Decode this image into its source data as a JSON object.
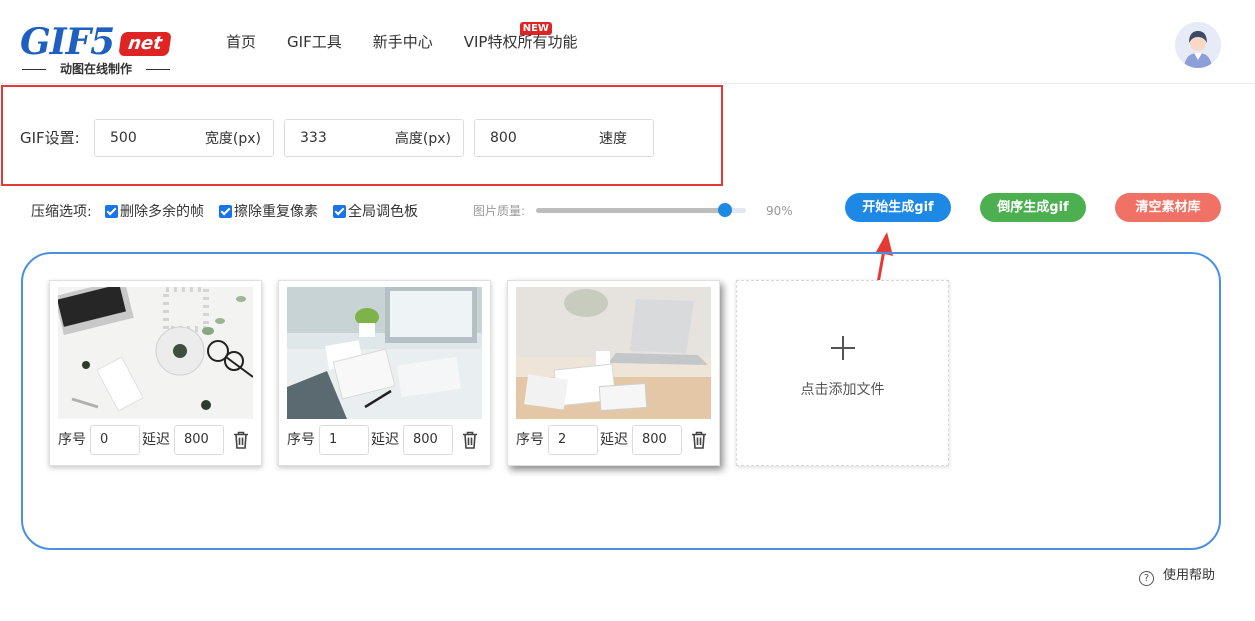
{
  "brand": {
    "logo_text": "GIF5",
    "logo_suffix": "net",
    "tagline": "动图在线制作"
  },
  "nav": [
    {
      "label": "首页"
    },
    {
      "label": "GIF工具"
    },
    {
      "label": "新手中心"
    },
    {
      "label": "VIP特权",
      "badge": "NEW"
    },
    {
      "label": "所有功能"
    }
  ],
  "settings": {
    "label": "GIF设置:",
    "width": {
      "value": "500",
      "unit": "宽度(px)"
    },
    "height": {
      "value": "333",
      "unit": "高度(px)"
    },
    "speed": {
      "value": "800",
      "unit": "速度"
    }
  },
  "compression": {
    "label": "压缩选项:",
    "options": [
      {
        "label": "删除多余的帧",
        "checked": true
      },
      {
        "label": "擦除重复像素",
        "checked": true
      },
      {
        "label": "全局调色板",
        "checked": true
      }
    ],
    "quality_label": "图片质量:",
    "quality_value": "90%",
    "quality_fraction": 0.9
  },
  "actions": {
    "start": "开始生成gif",
    "reverse": "倒序生成gif",
    "clear": "清空素材库"
  },
  "frames": [
    {
      "order_label": "序号",
      "order": "0",
      "delay_label": "延迟",
      "delay": "800"
    },
    {
      "order_label": "序号",
      "order": "1",
      "delay_label": "延迟",
      "delay": "800"
    },
    {
      "order_label": "序号",
      "order": "2",
      "delay_label": "延迟",
      "delay": "800"
    }
  ],
  "add_file": "点击添加文件",
  "help": "使用帮助",
  "colors": {
    "accent_blue": "#1e88e5",
    "green": "#4caf50",
    "coral": "#f07165",
    "highlight_red": "#e53935",
    "brand_blue": "#1f5fbf"
  }
}
